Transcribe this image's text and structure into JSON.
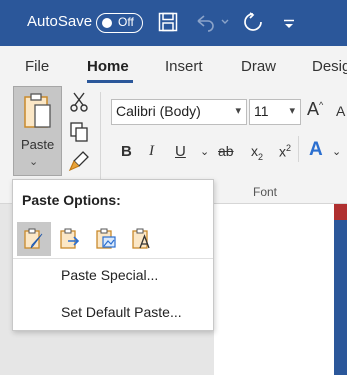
{
  "titlebar": {
    "autosave_label": "AutoSave",
    "autosave_state": "Off"
  },
  "tabs": [
    {
      "label": "File"
    },
    {
      "label": "Home",
      "active": true
    },
    {
      "label": "Insert"
    },
    {
      "label": "Draw"
    },
    {
      "label": "Desig"
    }
  ],
  "ribbon": {
    "paste_label": "Paste",
    "font_name": "Calibri (Body)",
    "font_size": "11",
    "font_group_label": "Font"
  },
  "paste_menu": {
    "heading": "Paste Options:",
    "options": [
      {
        "icon": "keep-source-formatting-icon",
        "selected": true
      },
      {
        "icon": "merge-formatting-icon"
      },
      {
        "icon": "picture-icon"
      },
      {
        "icon": "keep-text-only-icon"
      }
    ],
    "items": [
      {
        "label": "Paste Special..."
      },
      {
        "label": "Set Default Paste..."
      }
    ]
  },
  "colors": {
    "titlebar": "#2b579a",
    "ribbon": "#f3f3f3",
    "accent": "#2b579a"
  }
}
